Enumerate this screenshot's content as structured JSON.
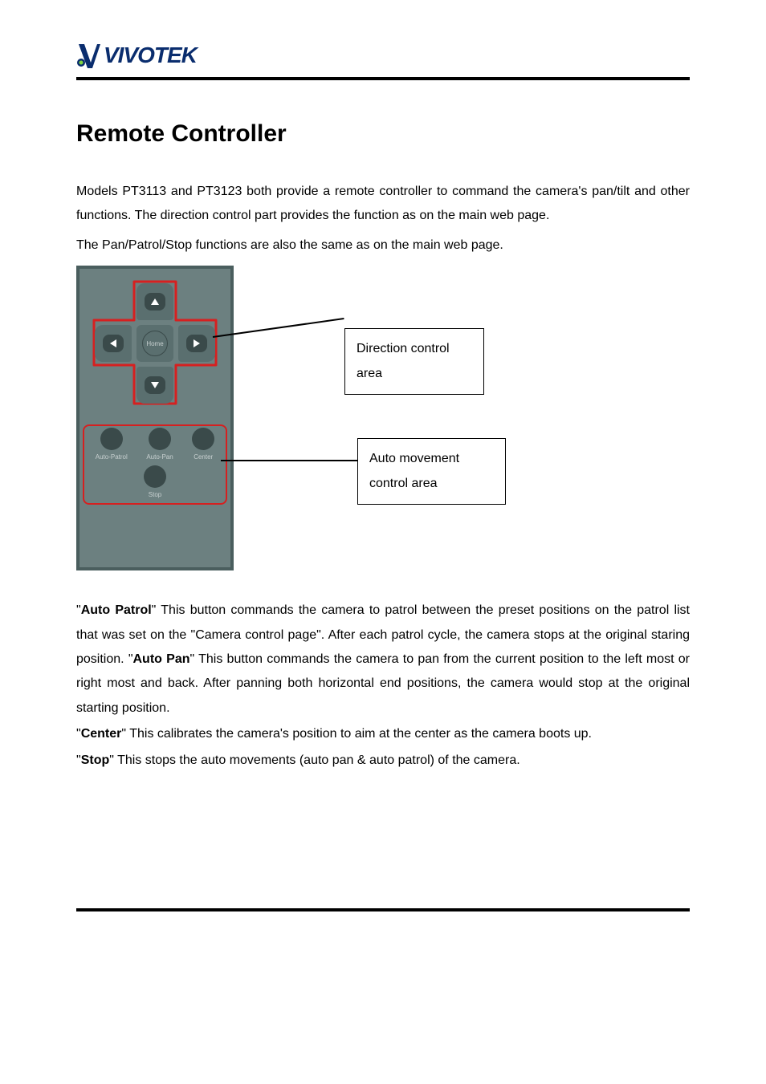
{
  "logo": {
    "brand_text": "VIVOTEK"
  },
  "title": "Remote Controller",
  "intro": "Models PT3113 and PT3123 both provide a remote controller to command the camera's pan/tilt and other functions. The direction control part provides the function as on the main web page.",
  "sub_intro": "The Pan/Patrol/Stop functions are also the same as on the main web page.",
  "remote": {
    "home_label": "Home",
    "auto_patrol_label": "Auto-Patrol",
    "auto_pan_label": "Auto-Pan",
    "center_label": "Center",
    "stop_label": "Stop"
  },
  "callouts": {
    "direction": "Direction control area",
    "auto": "Auto movement control area"
  },
  "descriptions": {
    "auto_patrol_label": "Auto Patrol",
    "auto_patrol_text_before": "\"",
    "auto_patrol_text_after": "\" This button commands the camera to patrol between the preset positions on the patrol list that was set on the \"Camera control page\". After each patrol cycle, the camera stops at the original staring position. \"",
    "auto_pan_label": "Auto Pan",
    "auto_pan_text_after": "\" This button commands the camera to pan from the current position to the left most or right most and back. After panning both horizontal end positions, the camera would stop at the original starting position.",
    "center_label": "Center",
    "center_text_before": "\"",
    "center_text_after": "\" This calibrates the camera's position to aim at the center as the camera boots up.",
    "stop_label": "Stop",
    "stop_text_before": "\"",
    "stop_text_after": "\" This stops the auto movements (auto pan & auto patrol) of the camera."
  }
}
